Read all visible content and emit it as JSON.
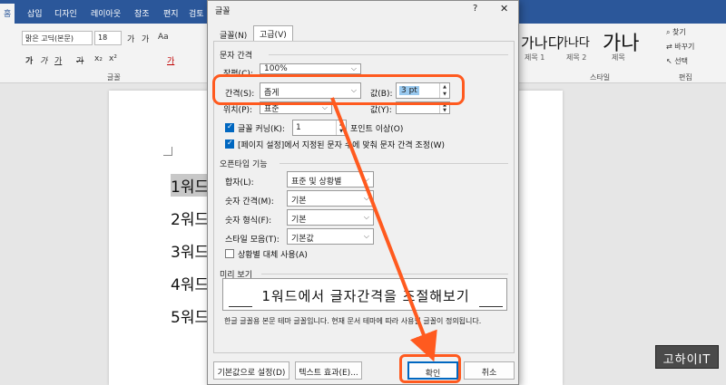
{
  "word": {
    "tabs": [
      "홈",
      "삽입",
      "디자인",
      "레이아웃",
      "참조",
      "편지",
      "검토"
    ],
    "font_name": "맑은 고딕(본문)",
    "font_size": "18",
    "ribbon_glyphs": [
      "가",
      "가",
      "Aa",
      "가",
      "가",
      "가",
      "가",
      "x₂",
      "x²"
    ],
    "font_group_label": "글꼴",
    "style_samples": [
      "가나디",
      "가나다",
      "가나"
    ],
    "style_names": [
      "제목 1",
      "제목 2",
      "제목"
    ],
    "style_group_label": "스타일",
    "editing": {
      "find": "찾기",
      "replace": "바꾸기",
      "select": "선택",
      "group_label": "편집"
    }
  },
  "document": {
    "lines": [
      "1워드",
      "2워드",
      "3워드",
      "4워드",
      "5워드"
    ]
  },
  "dialog": {
    "title": "글꼴",
    "help": "?",
    "close": "✕",
    "tabs": [
      "글꼴(N)",
      "고급(V)"
    ],
    "section_spacing": "문자 간격",
    "scale_label": "장평(C):",
    "scale_value": "100%",
    "spacing_label": "간격(S):",
    "spacing_value": "좁게",
    "by_label": "값(B):",
    "by_value": "3 pt",
    "position_label": "위치(P):",
    "position_value": "표준",
    "by2_label": "값(Y):",
    "kerning_label": "글꼴 커닝(K):",
    "kerning_value": "1",
    "kerning_suffix": "포인트 이상(O)",
    "grid_label": "[페이지 설정]에서 지정된 문자 수에 맞춰 문자 간격 조정(W)",
    "section_opentype": "오픈타입 기능",
    "ligatures_label": "합자(L):",
    "ligatures_value": "표준 및 상황별",
    "num_spacing_label": "숫자 간격(M):",
    "num_spacing_value": "기본",
    "num_forms_label": "숫자 형식(F):",
    "num_forms_value": "기본",
    "stylistic_label": "스타일 모음(T):",
    "stylistic_value": "기본값",
    "contextual_label": "상황별 대체 사용(A)",
    "section_preview": "미리 보기",
    "preview_text": "1워드에서 글자간격을 조절해보기",
    "preview_note": "한글 글꼴용 본문 테마 글꼴입니다. 현재 문서 테마에 따라 사용될 글꼴이 정의됩니다.",
    "btn_default": "기본값으로 설정(D)",
    "btn_effects": "텍스트 효과(E)...",
    "btn_ok": "확인",
    "btn_cancel": "취소"
  },
  "watermark": "고하이IT",
  "colors": {
    "accent": "#2b579a",
    "annotation": "#ff5a1f",
    "selection": "#99c9ef"
  }
}
